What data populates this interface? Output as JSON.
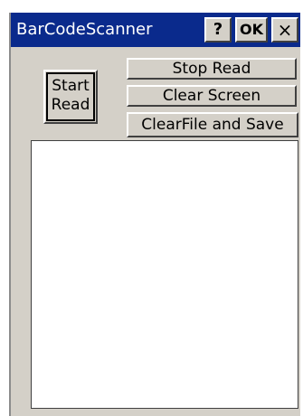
{
  "window": {
    "title": "BarCodeScanner",
    "help_label": "?",
    "ok_label": "OK",
    "close_label": "×"
  },
  "buttons": {
    "start_line1": "Start",
    "start_line2": "Read",
    "stop_read": "Stop Read",
    "clear_screen": "Clear Screen",
    "clear_file_save": "ClearFile and Save"
  },
  "output": {
    "value": ""
  },
  "colors": {
    "titlebar": "#0a2a8c",
    "face": "#d4d0c8",
    "text_area": "#ffffff"
  }
}
